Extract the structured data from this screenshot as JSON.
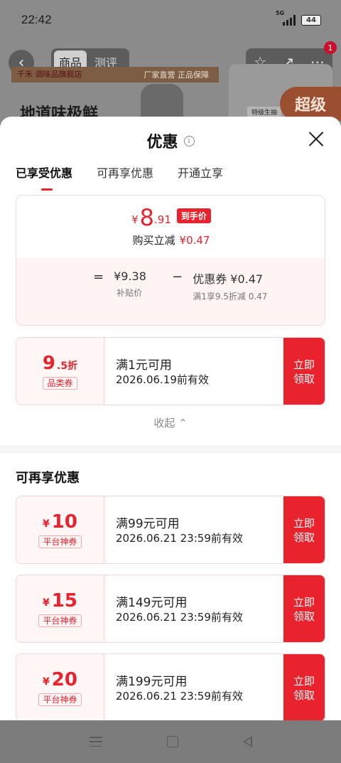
{
  "status_bar": {
    "time": "22:42",
    "network": "5G",
    "battery": "44"
  },
  "background_page": {
    "tabs": [
      "商品",
      "测评"
    ],
    "cart_badge": "1",
    "brand_name": "千禾 调味品旗舰店",
    "brand_strip": "厂家直营  正品保障",
    "headline": "地道味极鲜",
    "card_tag": "特级生抽",
    "promo_label": "超级"
  },
  "sheet": {
    "title": "优惠",
    "tabs": [
      {
        "label": "已享受优惠",
        "active": true
      },
      {
        "label": "可再享优惠",
        "active": false
      },
      {
        "label": "开通立享",
        "active": false
      }
    ],
    "summary": {
      "yen": "¥",
      "price_int": "8",
      "price_dec": ".91",
      "price_badge": "到手价",
      "reduce_label": "购买立减",
      "reduce_value": "¥0.47",
      "equals": "=",
      "base_value": "¥9.38",
      "base_label": "补贴价",
      "minus": "−",
      "coupon_value": "优惠券 ¥0.47",
      "coupon_label": "满1享9.5折减 0.47"
    },
    "applied_coupon": {
      "value": "9",
      "value_suffix": ".5折",
      "tag": "品类券",
      "condition": "满1元可用",
      "expiry": "2026.06.19前有效",
      "button": [
        "立即",
        "领取"
      ]
    },
    "collapse_label": "收起 ⌃",
    "more_section_title": "可再享优惠",
    "more_coupons": [
      {
        "yen": "¥",
        "value": "10",
        "tag": "平台神券",
        "condition": "满99元可用",
        "expiry": "2026.06.21 23:59前有效",
        "button": [
          "立即",
          "领取"
        ]
      },
      {
        "yen": "¥",
        "value": "15",
        "tag": "平台神券",
        "condition": "满149元可用",
        "expiry": "2026.06.21 23:59前有效",
        "button": [
          "立即",
          "领取"
        ]
      },
      {
        "yen": "¥",
        "value": "20",
        "tag": "平台神券",
        "condition": "满199元可用",
        "expiry": "2026.06.21 23:59前有效",
        "button": [
          "立即",
          "领取"
        ]
      }
    ]
  },
  "colors": {
    "accent": "#e8232e",
    "coupon_bg": "#fff6f6",
    "overlay": "#8b8b8b"
  }
}
